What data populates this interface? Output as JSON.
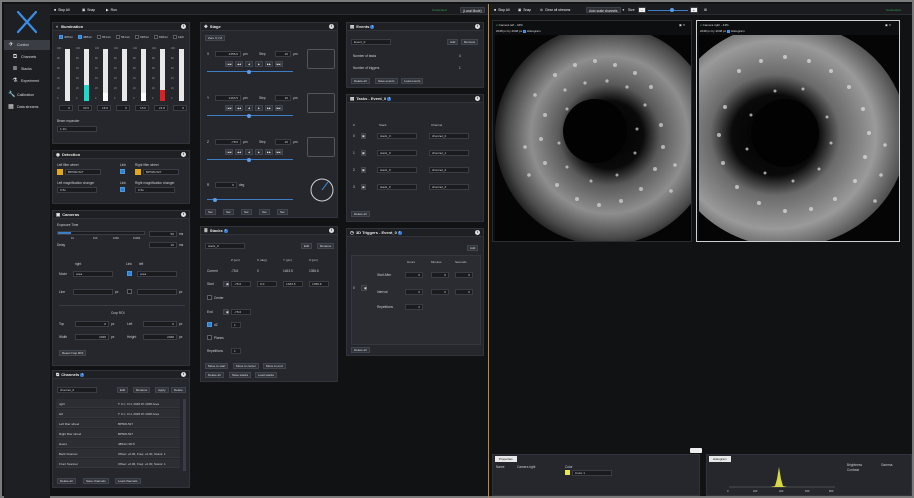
{
  "toolbar_left": {
    "stop_all": "Stop All",
    "snap": "Snap",
    "run": "Run",
    "status": "Connected",
    "mode": "(Local Mode)"
  },
  "toolbar_right": {
    "stop_all": "Stop All",
    "snap": "Snap",
    "clear_all_streams": "Clear all streams",
    "auto_scale": "Auto scale channels",
    "size_label": "Size",
    "status": "Connected"
  },
  "sidebar": {
    "items": [
      {
        "label": "Control",
        "icon": "airplane-icon"
      },
      {
        "label": "Channels",
        "icon": "channels-icon"
      },
      {
        "label": "Stacks",
        "icon": "stacks-icon"
      },
      {
        "label": "Experiment",
        "icon": "flask-icon"
      },
      {
        "label": "Calibration",
        "icon": "wrench-icon"
      },
      {
        "label": "Data streams",
        "icon": "table-icon"
      }
    ]
  },
  "illumination": {
    "title": "Illumination",
    "channels": [
      {
        "wl": "405nm",
        "value": "0",
        "level": 0.0,
        "color": "#6a6cff"
      },
      {
        "wl": "488nm",
        "value": "30.5",
        "level": 0.31,
        "color": "#20d8c8"
      },
      {
        "wl": "561nm",
        "value": "16.0",
        "level": 0.16,
        "color": "#ffffff"
      },
      {
        "wl": "561nm",
        "value": "0",
        "level": 0.0,
        "color": "#ffffff"
      },
      {
        "wl": "638nm",
        "value": "15.0",
        "level": 0.15,
        "color": "#ffffff"
      },
      {
        "wl": "638nm",
        "value": "21.8",
        "level": 0.22,
        "color": "#e02020"
      },
      {
        "wl": "LED",
        "value": "0",
        "level": 0.0,
        "color": "#ffffff"
      }
    ],
    "scale": [
      "100",
      "80",
      "60",
      "40",
      "20",
      "0"
    ],
    "beam_expander_label": "Beam expander",
    "beam_expander_value": "1 Iris"
  },
  "detection": {
    "title": "Detection",
    "left_filter_label": "Left filter wheel",
    "left_filter_value": "BP500-527",
    "link1": "Link",
    "right_filter_label": "Right filter wheel",
    "right_filter_value": "BP500-527",
    "left_mag_label": "Left magnification changer",
    "left_mag_value": "0.5x",
    "link2": "Link",
    "right_mag_label": "Right magnification changer",
    "right_mag_value": "0.5x"
  },
  "cameras": {
    "title": "Cameras",
    "exposure_label": "Exposure Time",
    "exposure_value": "50",
    "exposure_unit": "ms",
    "exposure_level": 0.15,
    "delay_label": "Delay",
    "delay_value": "15",
    "delay_unit": "ms",
    "ticks": [
      "1",
      "10",
      "100",
      "1000",
      "10000"
    ],
    "right": "right",
    "link": "Link",
    "left": "left",
    "mode_label": "Mode",
    "mode_right": "area",
    "mode_left": "area",
    "line_label": "Line",
    "line_unit": "px",
    "crop_roi": "Crop ROI",
    "top_label": "Top",
    "top_value": "0",
    "top_unit": "px",
    "left_label": "Left",
    "left_value": "0",
    "left_unit": "px",
    "width_label": "Width",
    "width_value": "2048",
    "width_unit": "px",
    "height_label": "Height",
    "height_value": "2048",
    "height_unit": "px",
    "reset_crop": "Reset Crop ROI"
  },
  "channels": {
    "title": "Channels",
    "selected": "channel_0",
    "buttons": [
      "Edit",
      "Rename",
      "Apply",
      "Delete"
    ],
    "rows": [
      {
        "k": "right",
        "v": "T: 0 L: 0 H: 2048 W: 2048 Area"
      },
      {
        "k": "left",
        "v": "T: 0 L: 0 H: 2048 W: 2048 Area"
      },
      {
        "k": "Left filter wheel",
        "v": "BP500-527"
      },
      {
        "k": "Right filter wheel",
        "v": "BP500-527"
      },
      {
        "k": "lasers",
        "v": "488nm=30.5"
      },
      {
        "k": "Back Scanner",
        "v": "Offset: +0.00, Freq: +0.30, Scans: 1"
      },
      {
        "k": "Front Scanner",
        "v": "Offset: +0.00, Freq: +0.30, Scans: 1"
      }
    ],
    "footer": [
      "Delete all",
      "Save channels",
      "Load channels"
    ]
  },
  "stage": {
    "title": "Stage",
    "zero_label": "Zero X,Y,Z",
    "x_value": "1356.6",
    "x_step": "10",
    "unit": "µm",
    "y_value": "1463.5",
    "y_step": "10",
    "z_value": "-78.6",
    "z_step": "10",
    "r_value": "0",
    "r_unit": "deg",
    "step_label": "Step",
    "nav": [
      "|◀◀",
      "◀◀",
      "◀",
      "▶",
      "▶▶",
      "▶▶|"
    ],
    "footer": [
      "Set",
      "Set",
      "Set",
      "Set",
      "Set"
    ]
  },
  "stacks": {
    "title": "Stacks",
    "selected": "stack_0",
    "buttons": [
      "Edit",
      "Rename"
    ],
    "headers": [
      "Z (µm)",
      "X (deg)",
      "Y (µm)",
      "Z (µm)"
    ],
    "current_label": "Current",
    "current": [
      "-78.6",
      "0",
      "1463.5",
      "1356.6"
    ],
    "start_label": "Start",
    "start": [
      "-78.6",
      "0.0",
      "1463.5",
      "1356.6"
    ],
    "center_label": "Center",
    "end_label": "End",
    "end": "-78.6",
    "dz_label": "dZ",
    "dz": "1",
    "planes_label": "Planes",
    "repetitions_label": "Repetitions",
    "repetitions": "1",
    "actions": [
      "Move to start",
      "Move to center",
      "Move to end"
    ],
    "footer": [
      "Delete all",
      "Save stacks",
      "Load stacks"
    ]
  },
  "events": {
    "title": "Events",
    "selected": "Event_0",
    "buttons": [
      "Add",
      "Remove"
    ],
    "tasks_label": "Number of tasks",
    "tasks_value": "4",
    "triggers_label": "Number of triggers",
    "triggers_value": "1",
    "footer": [
      "Delete all",
      "Save events",
      "Load events"
    ]
  },
  "tasks": {
    "title": "Tasks - Event_0",
    "headers": [
      "#",
      "Stack",
      "Channel"
    ],
    "rows": [
      {
        "n": "0",
        "stack": "stack_0",
        "channel": "channel_0"
      },
      {
        "n": "1",
        "stack": "stack_0",
        "channel": "channel_1"
      },
      {
        "n": "2",
        "stack": "stack_0",
        "channel": "channel_2"
      },
      {
        "n": "3",
        "stack": "stack_0",
        "channel": "channel_3"
      }
    ],
    "footer": "Delete all"
  },
  "triggers": {
    "title": "3D Triggers - Event_0",
    "add": "Add",
    "headers": [
      "Hours",
      "Minutes",
      "Seconds"
    ],
    "row_index": "0",
    "start_after_label": "Start After",
    "start_after": [
      "0",
      "0",
      "0"
    ],
    "interval_label": "Interval",
    "interval": [
      "0",
      "0",
      "0"
    ],
    "repetitions_label": "Repetitions",
    "repetitions": "2",
    "footer": "Delete all"
  },
  "viewers": [
    {
      "title": "Camera left - 44%",
      "subtitle": "2048 px by 2048 px",
      "hist": "Histogram"
    },
    {
      "title": "Camera right - 44%",
      "subtitle": "2048 px by 2048 px",
      "hist": "Histogram"
    }
  ],
  "properties": {
    "tab": "Properties",
    "name_label": "Name",
    "name_value": "Camera right",
    "color_label": "Color",
    "color_value": "Color 1"
  },
  "histogram": {
    "tab": "Histogram",
    "brightness": "Brightness",
    "contrast": "Contrast",
    "gamma": "Gamma",
    "axis": [
      "0",
      "200",
      "400",
      "600",
      "800"
    ]
  }
}
